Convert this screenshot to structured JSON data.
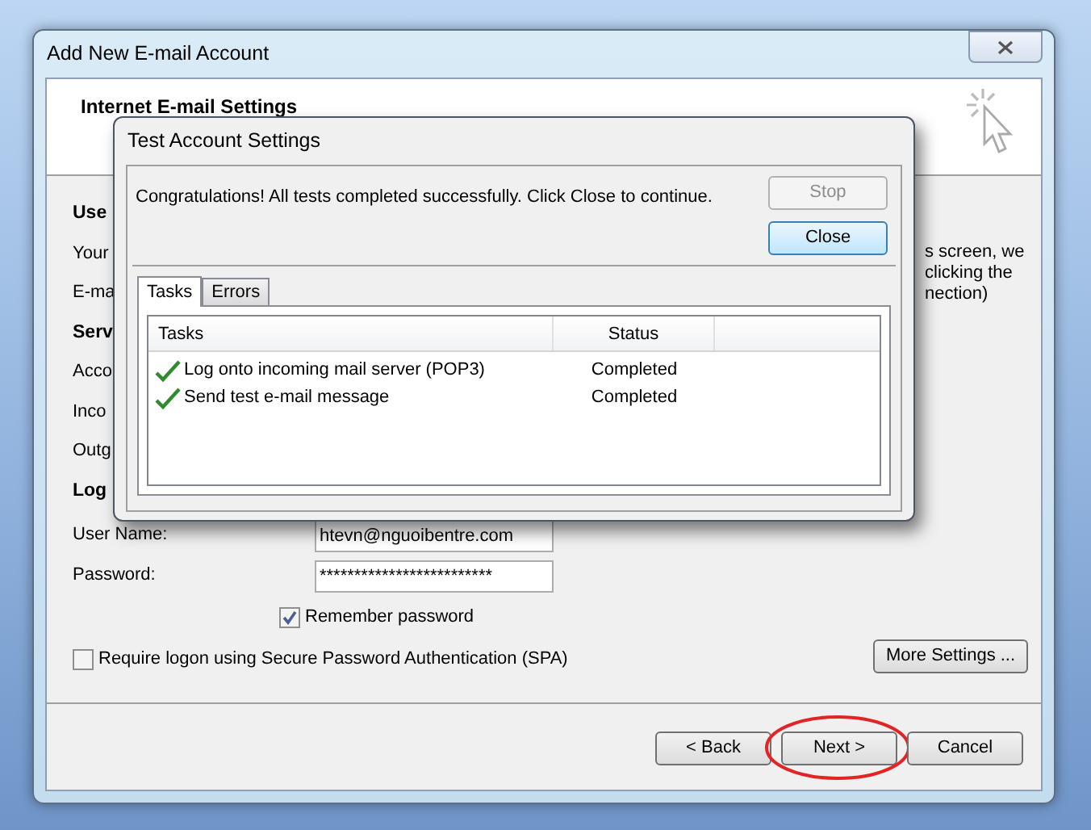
{
  "window": {
    "title": "Add New E-mail Account"
  },
  "header": {
    "title": "Internet E-mail Settings"
  },
  "form": {
    "left_labels": [
      {
        "text": "Use",
        "kind": "heading"
      },
      {
        "text": "Your",
        "kind": "label"
      },
      {
        "text": "E-ma",
        "kind": "label"
      },
      {
        "text": "Serv",
        "kind": "heading"
      },
      {
        "text": "Acco",
        "kind": "label"
      },
      {
        "text": "Inco",
        "kind": "label"
      },
      {
        "text": "Outg",
        "kind": "label"
      },
      {
        "text": "Log",
        "kind": "heading"
      }
    ],
    "right_text": [
      "s screen, we",
      "clicking the",
      "nection)"
    ],
    "fields": [
      {
        "label": "User Name:",
        "value": "htevn@nguoibentre.com"
      },
      {
        "label": "Password:",
        "value": "*************************"
      }
    ],
    "checkboxes": [
      {
        "label": "Remember password",
        "checked": true
      },
      {
        "label": "Require logon using Secure Password Authentication (SPA)",
        "checked": false
      }
    ],
    "more_settings": "More Settings ..."
  },
  "footer": {
    "buttons": [
      {
        "label": "< Back",
        "circled": false
      },
      {
        "label": "Next >",
        "circled": true
      },
      {
        "label": "Cancel",
        "circled": false
      }
    ]
  },
  "dialog": {
    "title": "Test Account Settings",
    "message": "Congratulations! All tests completed successfully. Click Close to continue.",
    "buttons": [
      {
        "label": "Stop",
        "disabled": true,
        "default": false
      },
      {
        "label": "Close",
        "disabled": false,
        "default": true
      }
    ],
    "tabs": [
      {
        "label": "Tasks",
        "selected": true
      },
      {
        "label": "Errors",
        "selected": false
      }
    ],
    "columns": [
      "Tasks",
      "Status"
    ],
    "rows": [
      {
        "task": "Log onto incoming mail server (POP3)",
        "status": "Completed",
        "done": true
      },
      {
        "task": "Send test e-mail message",
        "status": "Completed",
        "done": true
      }
    ]
  }
}
